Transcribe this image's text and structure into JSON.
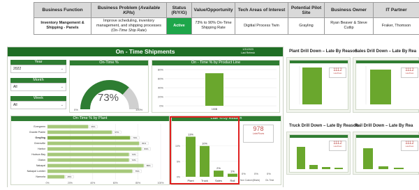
{
  "use_case": {
    "headers": [
      "Business Function",
      "Business Problem (Available KPIs)",
      "Status (R/Y/G)",
      "Value/Opportunity",
      "Tech Areas of Interest",
      "Potential Pilot Site",
      "Business Owner",
      "IT Partner"
    ],
    "header_problem_main": "Business Problem (",
    "header_problem_ital": "Available KPIs",
    "header_problem_end": ")",
    "function": "Inventory Mangement & Shipping - Panels",
    "problem_text": "Improve scheduling, inventory management, and shipping processes (On-",
    "problem_ital": "Time Ship Rate",
    "problem_end": ")",
    "status": "Active",
    "value": "73% to 90% On-Time Shipping Rate",
    "tech": "Digitial Process Twin",
    "site": "Grayling",
    "owner": "Ryan Beaver & Steve Cutlip",
    "it_partner": "Fraker, Thomson"
  },
  "dashboard": {
    "title": "On - Time Shipments",
    "meta_date": "1/31/2023",
    "meta_label": "Last Refresh",
    "filters": [
      {
        "label": "Year",
        "value": "2022"
      },
      {
        "label": "Month",
        "value": "All"
      },
      {
        "label": "Week",
        "value": "All"
      }
    ],
    "ontime_card_title": "On-Time %",
    "ontime_value": "73%",
    "ontime_fraction": 0.73,
    "gauge_min": "0%",
    "gauge_max": "100%",
    "product_line_title": "On - Time % by Product Line",
    "plant_title": "On-Time % by Plant",
    "late_title": "Late % by Reason",
    "late_total": "978",
    "late_total_label": "Late/Rows",
    "extra_pcts": [
      "0%",
      "0%",
      "0%"
    ],
    "extra_labels": [
      "(Blank)",
      "On-Time",
      "Non Custom"
    ],
    "right_panels": [
      {
        "title": "Plant Drill Down – Late By Reason",
        "value": "1112",
        "sub": "Late/Rows"
      },
      {
        "title": "Sales Drill Down – Late By Rea",
        "value": "1112",
        "sub": "Late/Rows"
      },
      {
        "title": "Truck Drill Down – Late By Reason",
        "value": "1112",
        "sub": "Late/Rows"
      },
      {
        "title": "Rail Drill Down – Late By Rea",
        "value": "1112",
        "sub": "Late/Rows"
      }
    ]
  },
  "chart_data": [
    {
      "type": "bar",
      "title": "On - Time % by Product Line",
      "categories": [
        "100B"
      ],
      "values": [
        72
      ],
      "ylim": [
        0,
        80
      ],
      "yticks": [
        "80%",
        "60%",
        "40%",
        "20%",
        "0%"
      ],
      "color": "#6aa72d"
    },
    {
      "type": "bar",
      "orientation": "horizontal",
      "title": "On-Time % by Plant",
      "categories": [
        "Evergreen",
        "Granite Prairie",
        "Grayling",
        "Greenville",
        "Harbor",
        "Hudson Bay",
        "Olaton",
        "Nakapal",
        "Nakapal Lumber",
        "Namoria"
      ],
      "values": [
        36,
        57,
        73,
        81,
        83,
        72,
        72,
        85,
        75,
        15
      ],
      "highlight": "Grayling",
      "xticks": [
        "0%",
        "20%",
        "40%",
        "60%",
        "80%",
        "100%"
      ],
      "xlim": [
        0,
        100
      ],
      "color": "#a6c87a"
    },
    {
      "type": "bar",
      "title": "Late % by Reason",
      "categories": [
        "Plant",
        "Truck",
        "Sales",
        "Rail"
      ],
      "values": [
        13,
        10,
        2,
        1
      ],
      "labels": [
        "13%",
        "10%",
        "2%",
        "1%"
      ],
      "ylim": [
        0,
        14
      ],
      "yticks": [
        "10%",
        "5%",
        "0%"
      ],
      "color": "#6aa72d"
    }
  ],
  "colors": {
    "brand_green": "#1f6e25",
    "bar_green": "#6aa72d",
    "status_green": "#1ea64a",
    "highlight_red": "#e02020",
    "value_red": "#c0504d"
  }
}
